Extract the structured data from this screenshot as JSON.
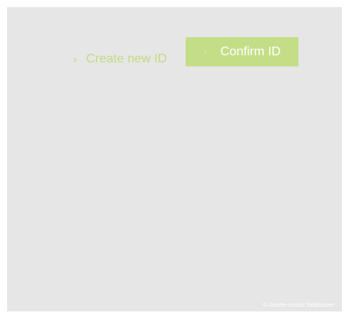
{
  "actions": {
    "create_label": "Create new ID",
    "confirm_label": "Confirm ID"
  },
  "icons": {
    "create_chevron": "›",
    "confirm_chevron": "›"
  },
  "footer": {
    "copyright": "© Goethe-Institut Seldonsten"
  },
  "colors": {
    "panel_bg": "#e6e6e6",
    "accent": "#c4de87",
    "link_text": "#c3da84"
  }
}
